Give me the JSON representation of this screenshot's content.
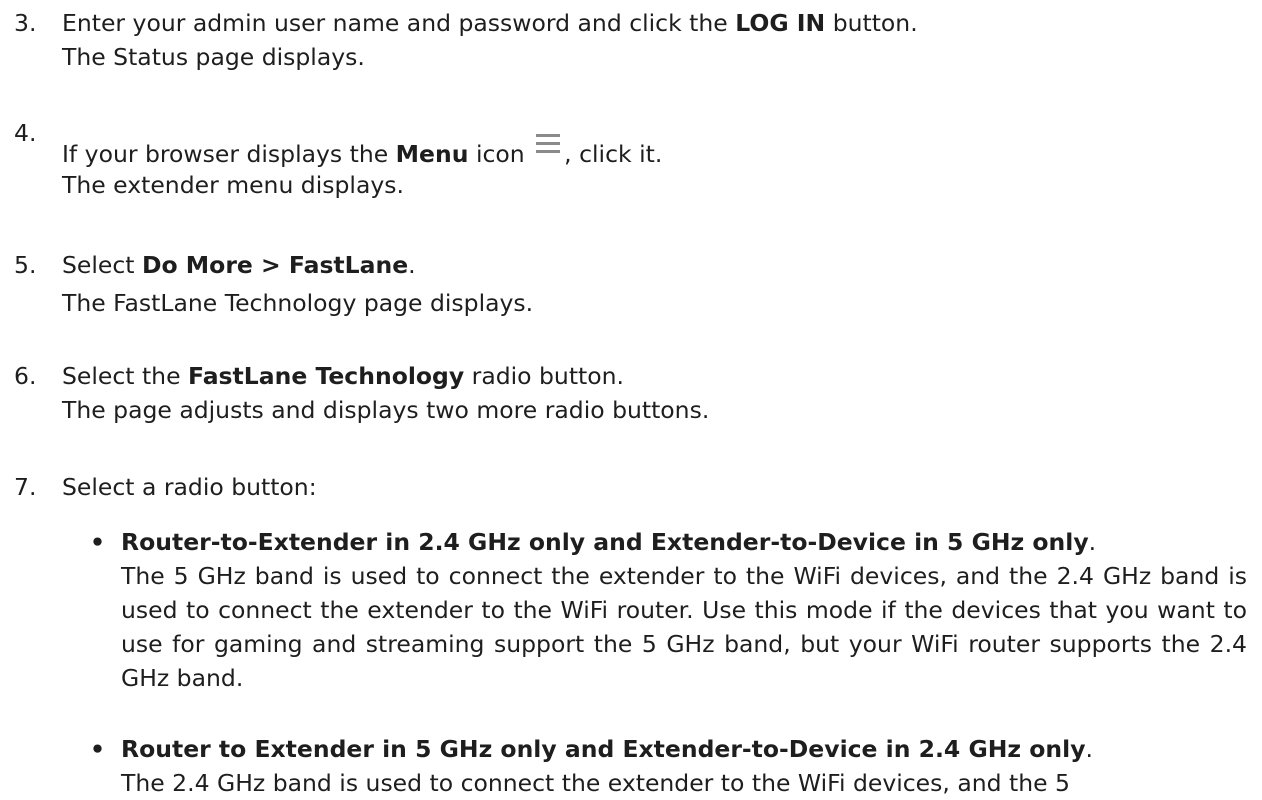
{
  "steps": [
    {
      "number": "3.",
      "before": "Enter your admin user name and password and click the ",
      "bold": "LOG IN",
      "after": " button.",
      "result": "The Status page displays."
    },
    {
      "number": "4.",
      "before": "If your browser displays the ",
      "bold": "Menu",
      "mid": " icon",
      "icon": "menu-icon",
      "after": ", click it.",
      "result": "The extender menu displays."
    },
    {
      "number": "5.",
      "before": "Select ",
      "bold": "Do More > FastLane",
      "after": ".",
      "result": "The FastLane Technology page displays."
    },
    {
      "number": "6.",
      "before": "Select the ",
      "bold": "FastLane Technology",
      "after": " radio button.",
      "result": "The page adjusts and displays two more radio buttons."
    },
    {
      "number": "7.",
      "text": "Select a radio button:",
      "options": [
        {
          "bullet": "•",
          "title": "Router-to-Extender in 2.4 GHz only and Extender-to-Device in 5 GHz only",
          "title_end": ".",
          "description": "The 5 GHz band is used to connect the extender to the WiFi devices, and the 2.4 GHz band is used to connect the extender to the WiFi router. Use this mode if the devices that you want to use for gaming and streaming support the 5 GHz band, but your WiFi router supports the 2.4 GHz band."
        },
        {
          "bullet": "•",
          "title": "Router to Extender in 5 GHz only and Extender-to-Device in 2.4 GHz only",
          "title_end": ".",
          "description": "The 2.4 GHz band is used to connect the extender to the WiFi devices, and the 5"
        }
      ]
    }
  ]
}
